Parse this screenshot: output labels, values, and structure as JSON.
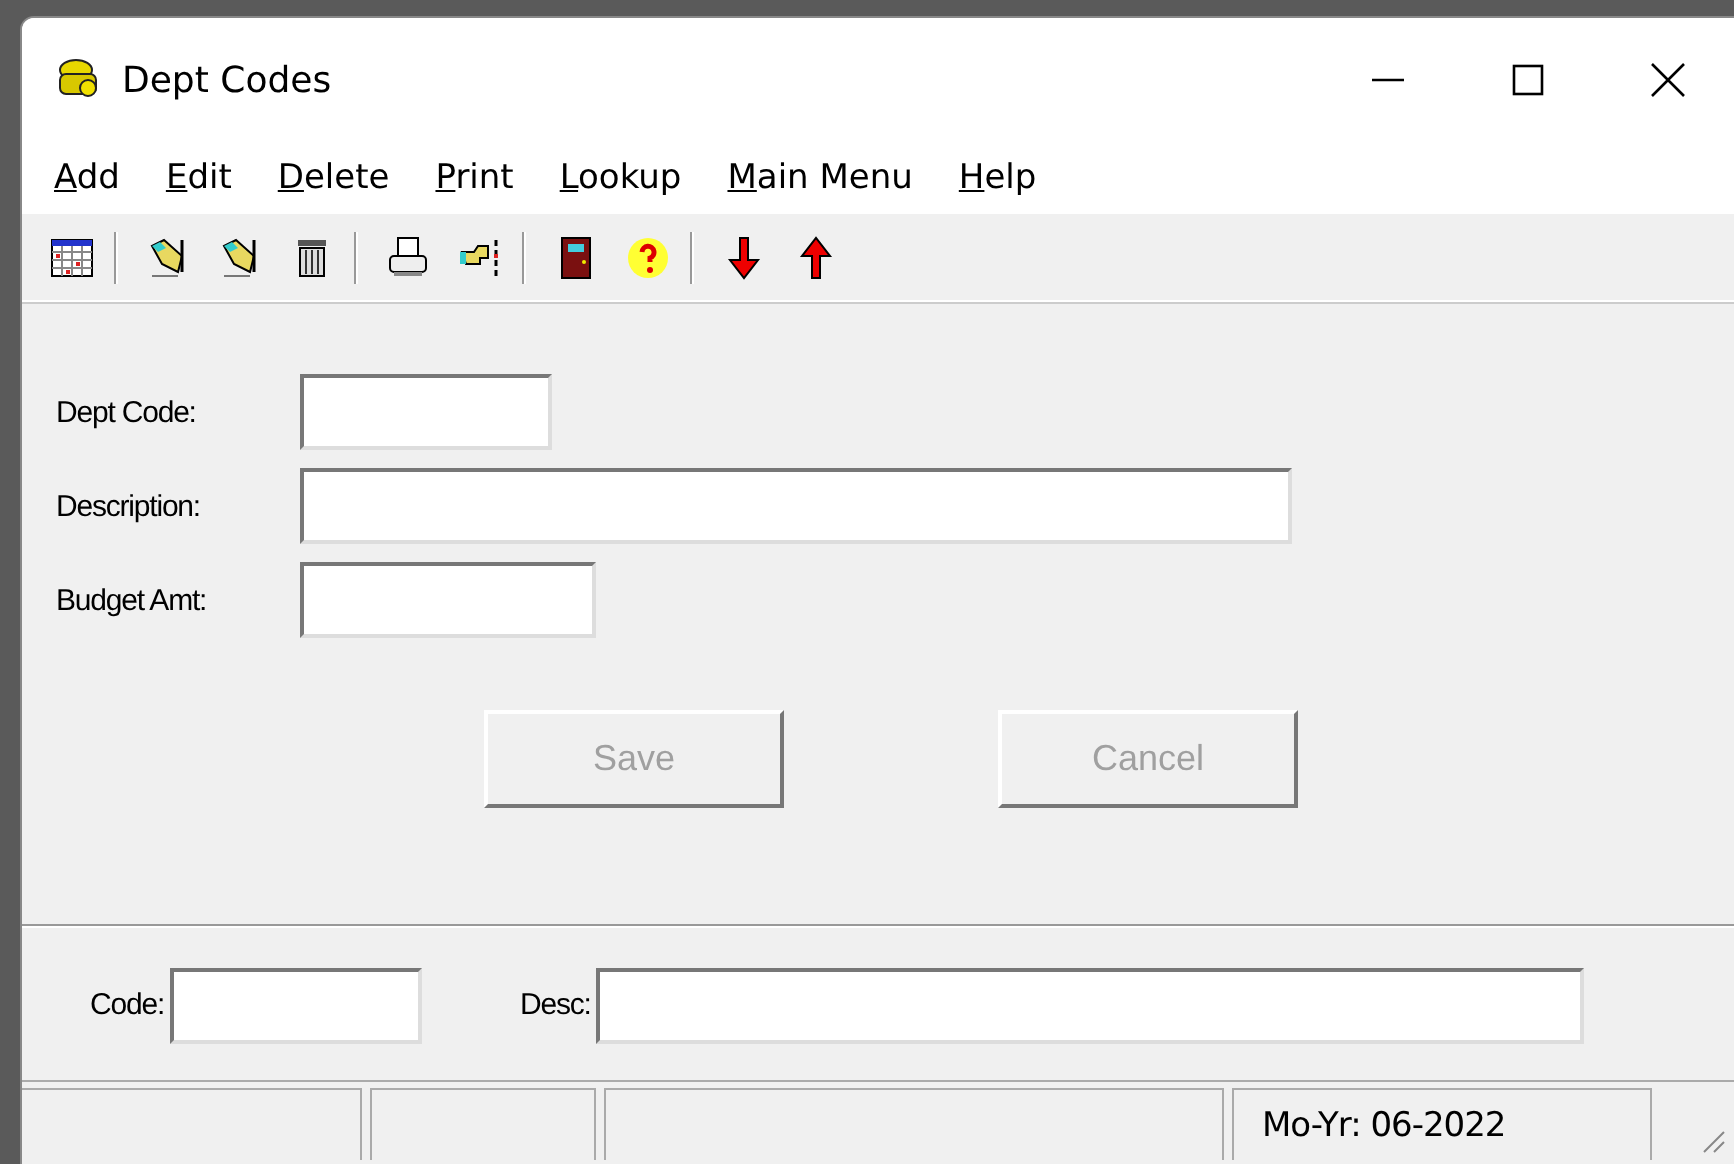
{
  "window": {
    "title": "Dept Codes"
  },
  "menu": [
    {
      "label": "Add"
    },
    {
      "label": "Edit"
    },
    {
      "label": "Delete"
    },
    {
      "label": "Print"
    },
    {
      "label": "Lookup"
    },
    {
      "label": "Main Menu"
    },
    {
      "label": "Help"
    }
  ],
  "toolbar": [
    {
      "kind": "calendar"
    },
    {
      "kind": "sep"
    },
    {
      "kind": "hand-pen"
    },
    {
      "kind": "hand-pen"
    },
    {
      "kind": "trash"
    },
    {
      "kind": "sep"
    },
    {
      "kind": "printer"
    },
    {
      "kind": "pointer"
    },
    {
      "kind": "sep"
    },
    {
      "kind": "door"
    },
    {
      "kind": "help"
    },
    {
      "kind": "sep"
    },
    {
      "kind": "down"
    },
    {
      "kind": "up"
    }
  ],
  "form": {
    "fields": [
      {
        "label": "Dept Code:"
      },
      {
        "label": "Description:"
      },
      {
        "label": "Budget Amt:"
      }
    ],
    "buttons": [
      {
        "label": "Save",
        "disabled": true
      },
      {
        "label": "Cancel",
        "disabled": true
      }
    ]
  },
  "lookup": {
    "fields": [
      {
        "label": "Code:"
      },
      {
        "label": "Desc:"
      }
    ]
  },
  "status_bar": {
    "text": "Mo-Yr: 06-2022"
  }
}
